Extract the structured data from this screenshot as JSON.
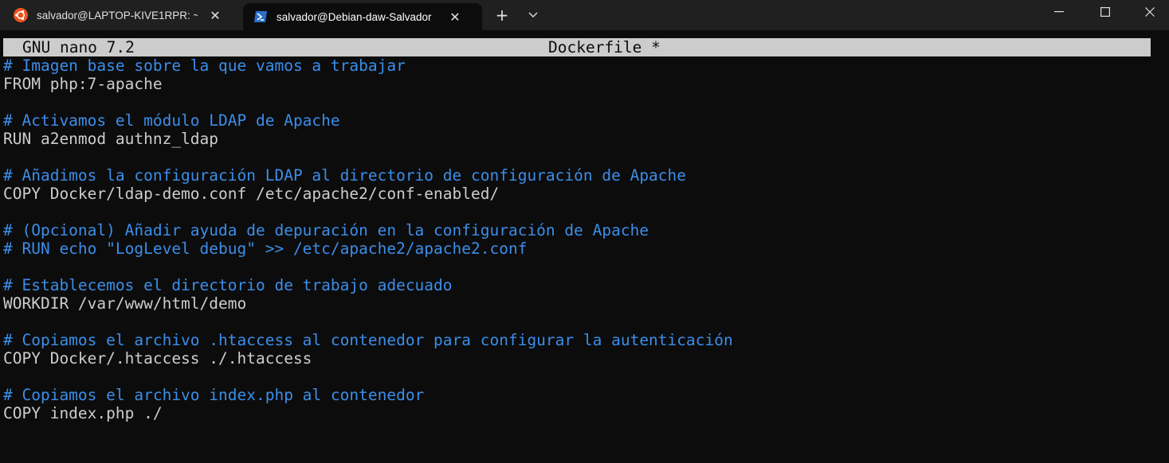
{
  "tabs": [
    {
      "title": "salvador@LAPTOP-KIVE1RPR: ~",
      "icon": "ubuntu-icon"
    },
    {
      "title": "salvador@Debian-daw-Salvador",
      "icon": "powershell-icon"
    }
  ],
  "window_controls": {
    "new_tab": "+",
    "dropdown": "chevron-down-icon"
  },
  "nano": {
    "version": "GNU nano 7.2",
    "filename": "Dockerfile *"
  },
  "lines": [
    {
      "type": "comment",
      "text": "# Imagen base sobre la que vamos a trabajar"
    },
    {
      "type": "code",
      "text": "FROM php:7-apache"
    },
    {
      "type": "blank",
      "text": ""
    },
    {
      "type": "comment",
      "text": "# Activamos el módulo LDAP de Apache"
    },
    {
      "type": "code",
      "text": "RUN a2enmod authnz_ldap"
    },
    {
      "type": "blank",
      "text": ""
    },
    {
      "type": "comment",
      "text": "# Añadimos la configuración LDAP al directorio de configuración de Apache"
    },
    {
      "type": "code",
      "text": "COPY Docker/ldap-demo.conf /etc/apache2/conf-enabled/"
    },
    {
      "type": "blank",
      "text": ""
    },
    {
      "type": "comment",
      "text": "# (Opcional) Añadir ayuda de depuración en la configuración de Apache"
    },
    {
      "type": "comment",
      "text": "# RUN echo \"LogLevel debug\" >> /etc/apache2/apache2.conf"
    },
    {
      "type": "blank",
      "text": ""
    },
    {
      "type": "comment",
      "text": "# Establecemos el directorio de trabajo adecuado"
    },
    {
      "type": "code",
      "text": "WORKDIR /var/www/html/demo"
    },
    {
      "type": "blank",
      "text": ""
    },
    {
      "type": "comment",
      "text": "# Copiamos el archivo .htaccess al contenedor para configurar la autenticación"
    },
    {
      "type": "code",
      "text": "COPY Docker/.htaccess ./.htaccess"
    },
    {
      "type": "blank",
      "text": ""
    },
    {
      "type": "comment",
      "text": "# Copiamos el archivo index.php al contenedor"
    },
    {
      "type": "code",
      "text": "COPY index.php ./"
    }
  ],
  "colors": {
    "comment": "#3b8eea",
    "text": "#cccccc",
    "background": "#0c0c0c",
    "header_bg": "#cccccc",
    "ubuntu_orange": "#e95420"
  }
}
